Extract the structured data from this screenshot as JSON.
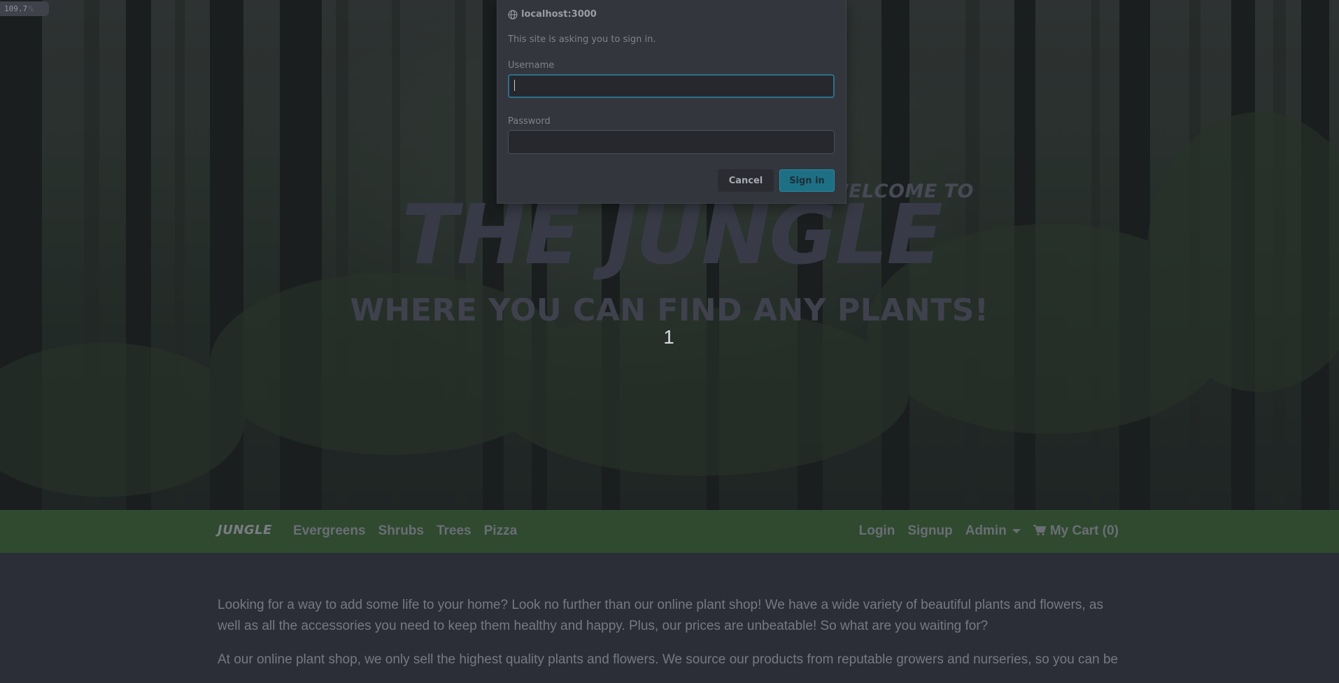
{
  "zoom": {
    "value": "109.7",
    "unit": "%"
  },
  "hero": {
    "welcome": "WELCOME TO",
    "title": "THE JUNGLE",
    "tagline": "WHERE YOU CAN FIND ANY PLANTS!",
    "counter": "1"
  },
  "navbar": {
    "brand": "JUNGLE",
    "left_links": [
      "Evergreens",
      "Shrubs",
      "Trees",
      "Pizza"
    ],
    "login": "Login",
    "signup": "Signup",
    "admin": "Admin",
    "cart": "My Cart (0)"
  },
  "content": {
    "paragraphs": [
      "Looking for a way to add some life to your home? Look no further than our online plant shop! We have a wide variety of beautiful plants and flowers, as well as all the accessories you need to keep them healthy and happy. Plus, our prices are unbeatable! So what are you waiting for?",
      "At our online plant shop, we only sell the highest quality plants and flowers. We source our products from reputable growers and nurseries, so you can be"
    ]
  },
  "auth_dialog": {
    "origin": "localhost:3000",
    "message": "This site is asking you to sign in.",
    "username_label": "Username",
    "username_value": "",
    "password_label": "Password",
    "password_value": "",
    "cancel": "Cancel",
    "sign_in": "Sign in"
  },
  "icons": {
    "origin": "globe-icon",
    "cart": "cart-icon",
    "admin_menu": "caret-down-icon"
  },
  "colors": {
    "navbar": "#2f4a2f",
    "sign_in_button": "#1d6f84",
    "focus_ring": "#2d6f8a",
    "page_bg": "#2b2e36"
  }
}
